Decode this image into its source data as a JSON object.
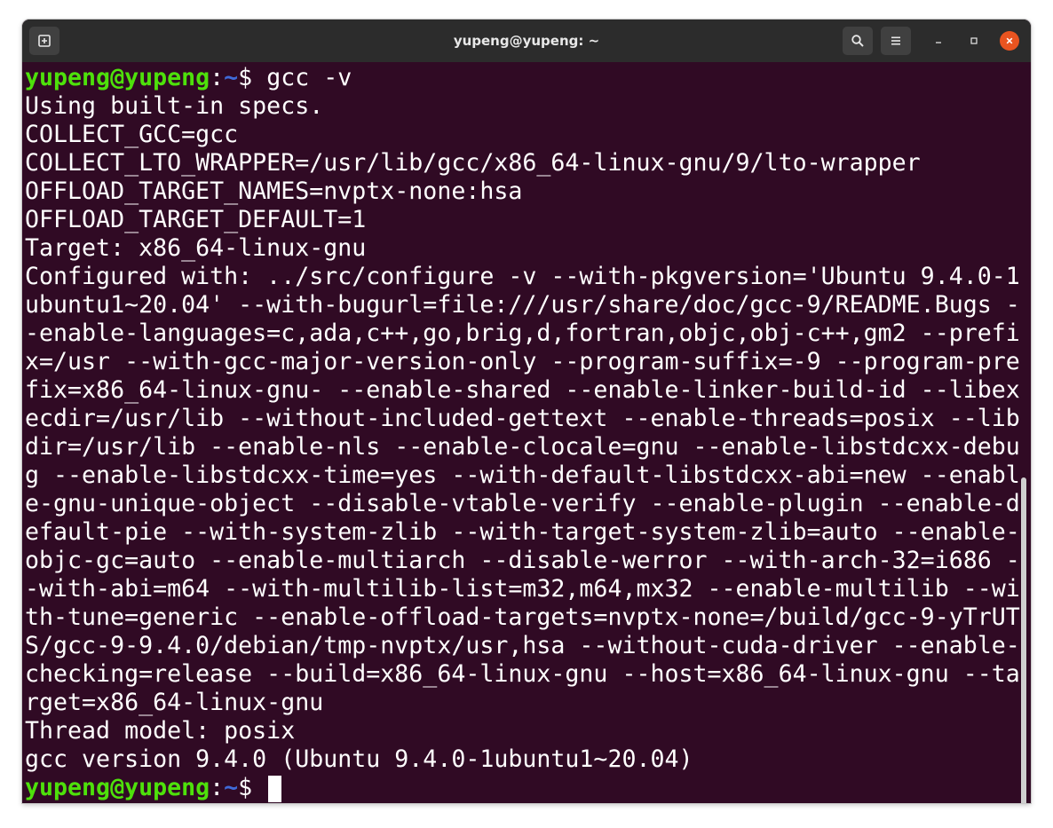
{
  "window": {
    "title": "yupeng@yupeng: ~"
  },
  "icons": {
    "new_tab": "new-tab-icon",
    "search": "search-icon",
    "menu": "hamburger-menu-icon",
    "minimize": "minimize-icon",
    "maximize": "maximize-icon",
    "close": "close-icon"
  },
  "colors": {
    "terminal_bg": "#300a24",
    "user_host": "#4ee10b",
    "path": "#3f6ad8",
    "close": "#e95420"
  },
  "terminal": {
    "prompt": {
      "user": "yupeng@yupeng",
      "colon": ":",
      "cwd": "~",
      "symbol": "$ "
    },
    "command": "gcc -v",
    "output": [
      "Using built-in specs.",
      "COLLECT_GCC=gcc",
      "COLLECT_LTO_WRAPPER=/usr/lib/gcc/x86_64-linux-gnu/9/lto-wrapper",
      "OFFLOAD_TARGET_NAMES=nvptx-none:hsa",
      "OFFLOAD_TARGET_DEFAULT=1",
      "Target: x86_64-linux-gnu",
      "Configured with: ../src/configure -v --with-pkgversion='Ubuntu 9.4.0-1",
      "ubuntu1~20.04' --with-bugurl=file:///usr/share/doc/gcc-9/README.Bugs -",
      "-enable-languages=c,ada,c++,go,brig,d,fortran,objc,obj-c++,gm2 --prefi",
      "x=/usr --with-gcc-major-version-only --program-suffix=-9 --program-pre",
      "fix=x86_64-linux-gnu- --enable-shared --enable-linker-build-id --libex",
      "ecdir=/usr/lib --without-included-gettext --enable-threads=posix --lib",
      "dir=/usr/lib --enable-nls --enable-clocale=gnu --enable-libstdcxx-debu",
      "g --enable-libstdcxx-time=yes --with-default-libstdcxx-abi=new --enabl",
      "e-gnu-unique-object --disable-vtable-verify --enable-plugin --enable-d",
      "efault-pie --with-system-zlib --with-target-system-zlib=auto --enable-",
      "objc-gc=auto --enable-multiarch --disable-werror --with-arch-32=i686 -",
      "-with-abi=m64 --with-multilib-list=m32,m64,mx32 --enable-multilib --wi",
      "th-tune=generic --enable-offload-targets=nvptx-none=/build/gcc-9-yTrUT",
      "S/gcc-9-9.4.0/debian/tmp-nvptx/usr,hsa --without-cuda-driver --enable-",
      "checking=release --build=x86_64-linux-gnu --host=x86_64-linux-gnu --ta",
      "rget=x86_64-linux-gnu",
      "Thread model: posix",
      "gcc version 9.4.0 (Ubuntu 9.4.0-1ubuntu1~20.04)"
    ]
  }
}
